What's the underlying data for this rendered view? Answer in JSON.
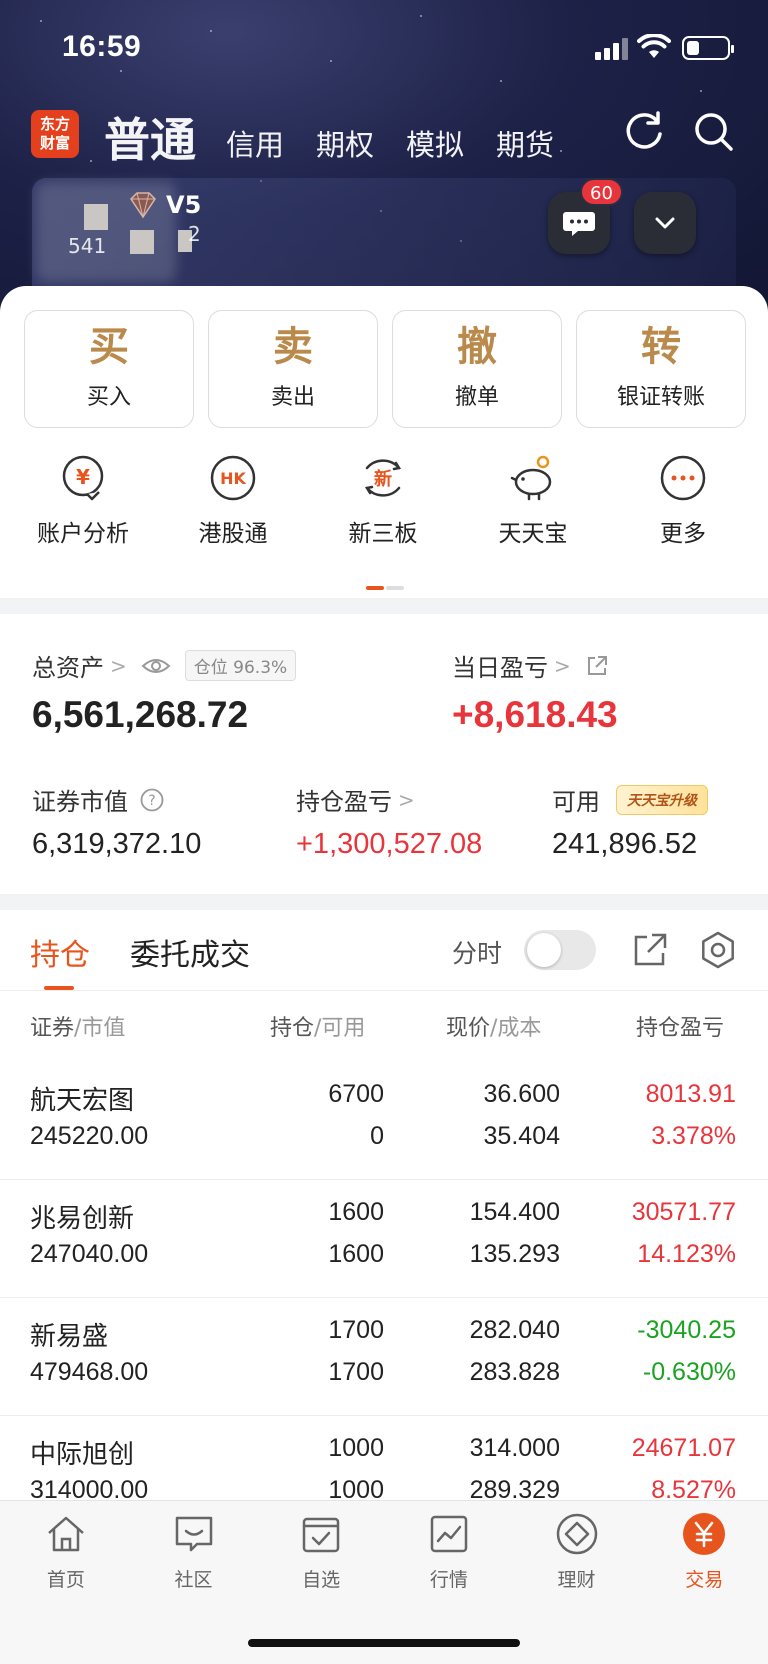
{
  "status": {
    "time": "16:59"
  },
  "brand": {
    "logo_line1": "东方",
    "logo_line2": "财富"
  },
  "header_tabs": [
    {
      "label": "普通",
      "active": true
    },
    {
      "label": "信用"
    },
    {
      "label": "期权"
    },
    {
      "label": "模拟"
    },
    {
      "label": "期货"
    }
  ],
  "account": {
    "vip_level": "V5",
    "id_fragment": "541",
    "id_suffix": "2",
    "message_count": "60"
  },
  "big_actions": [
    {
      "char": "买",
      "label": "买入"
    },
    {
      "char": "卖",
      "label": "卖出"
    },
    {
      "char": "撤",
      "label": "撤单"
    },
    {
      "char": "转",
      "label": "银证转账"
    }
  ],
  "small_actions": [
    {
      "label": "账户分析",
      "icon": "account-analysis-icon",
      "glyph": "¥"
    },
    {
      "label": "港股通",
      "icon": "hk-connect-icon",
      "glyph": "HK"
    },
    {
      "label": "新三板",
      "icon": "neeq-icon",
      "glyph": "新"
    },
    {
      "label": "天天宝",
      "icon": "piggy-bank-icon"
    },
    {
      "label": "更多",
      "icon": "more-icon"
    }
  ],
  "assets": {
    "total_label": "总资产",
    "position_pill": "仓位 96.3%",
    "total_value": "6,561,268.72",
    "daily_pl_label": "当日盈亏",
    "daily_pl_value": "+8,618.43",
    "market_value_label": "证券市值",
    "market_value": "6,319,372.10",
    "holding_pl_label": "持仓盈亏",
    "holding_pl_value": "+1,300,527.08",
    "available_label": "可用",
    "upgrade_badge": "天天宝升级",
    "available_value": "241,896.52"
  },
  "holdings": {
    "tabs": [
      "持仓",
      "委托成交"
    ],
    "intraday_label": "分时",
    "intraday_on": false,
    "columns": [
      {
        "main": "证券",
        "sub": "/市值"
      },
      {
        "main": "持仓",
        "sub": "/可用"
      },
      {
        "main": "现价",
        "sub": "/成本"
      },
      {
        "main": "持仓盈亏",
        "sub": ""
      }
    ],
    "rows": [
      {
        "name": "航天宏图",
        "market_value": "245220.00",
        "position": "6700",
        "available": "0",
        "price": "36.600",
        "cost": "35.404",
        "pl": "8013.91",
        "pl_pct": "3.378%",
        "direction": "up"
      },
      {
        "name": "兆易创新",
        "market_value": "247040.00",
        "position": "1600",
        "available": "1600",
        "price": "154.400",
        "cost": "135.293",
        "pl": "30571.77",
        "pl_pct": "14.123%",
        "direction": "up"
      },
      {
        "name": "新易盛",
        "market_value": "479468.00",
        "position": "1700",
        "available": "1700",
        "price": "282.040",
        "cost": "283.828",
        "pl": "-3040.25",
        "pl_pct": "-0.630%",
        "direction": "down"
      },
      {
        "name": "中际旭创",
        "market_value": "314000.00",
        "position": "1000",
        "available": "1000",
        "price": "314.000",
        "cost": "289.329",
        "pl": "24671.07",
        "pl_pct": "8.527%",
        "direction": "up"
      }
    ]
  },
  "bottom_nav": [
    {
      "label": "首页",
      "icon": "home-icon"
    },
    {
      "label": "社区",
      "icon": "community-icon"
    },
    {
      "label": "自选",
      "icon": "watchlist-icon"
    },
    {
      "label": "行情",
      "icon": "market-icon"
    },
    {
      "label": "理财",
      "icon": "wealth-icon"
    },
    {
      "label": "交易",
      "icon": "trade-icon",
      "active": true
    }
  ],
  "colors": {
    "accent": "#e8541e",
    "up": "#e8353c",
    "down": "#1aa321",
    "gold": "#b98a4c"
  }
}
